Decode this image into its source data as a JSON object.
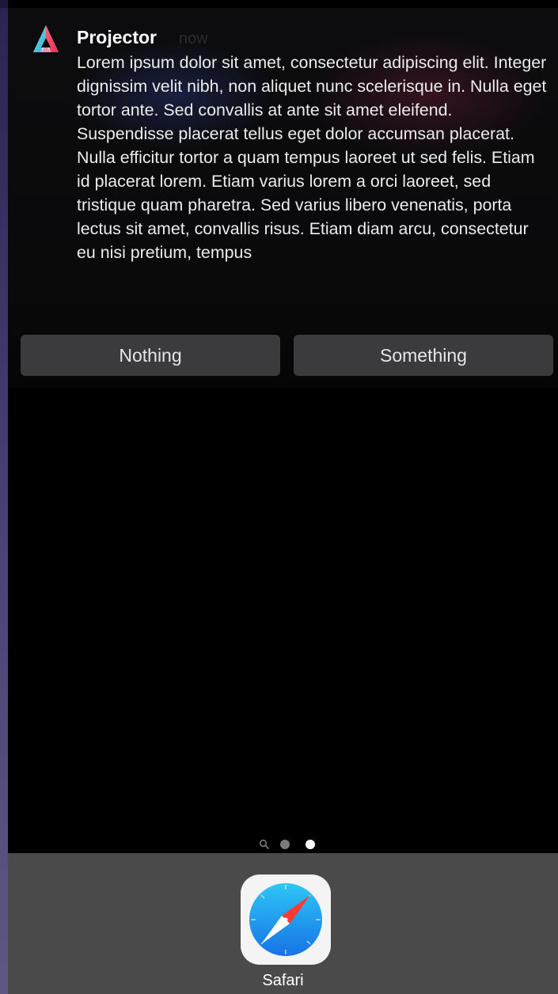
{
  "notification": {
    "app_name": "Projector",
    "time": "now",
    "body": "Lorem ipsum dolor sit amet, consectetur adipiscing elit. Integer dignissim velit nibh, non aliquet nunc scelerisque in. Nulla eget tortor ante. Sed convallis at ante sit amet eleifend. Suspendisse placerat tellus eget dolor accumsan placerat. Nulla efficitur tortor a quam tempus laoreet ut sed felis. Etiam id placerat lorem. Etiam varius lorem a orci laoreet, sed tristique quam pharetra. Sed varius libero venenatis, porta lectus sit amet, convallis risus. Etiam diam arcu, consectetur eu nisi pretium, tempus",
    "app_icon": "projector-app-icon",
    "actions": [
      {
        "label": "Nothing"
      },
      {
        "label": "Something"
      }
    ]
  },
  "page_indicator": {
    "search_icon": "search-icon",
    "active_page": 2,
    "page_count": 2
  },
  "dock": {
    "apps": [
      {
        "label": "Safari",
        "icon": "safari-compass-icon"
      }
    ]
  },
  "colors": {
    "screen_background": "#000000",
    "button_background": "#3b3b3d",
    "dock_background": "#4a4a4a",
    "accent_blue": "#1e90ff",
    "accent_red": "#ff3b30"
  }
}
